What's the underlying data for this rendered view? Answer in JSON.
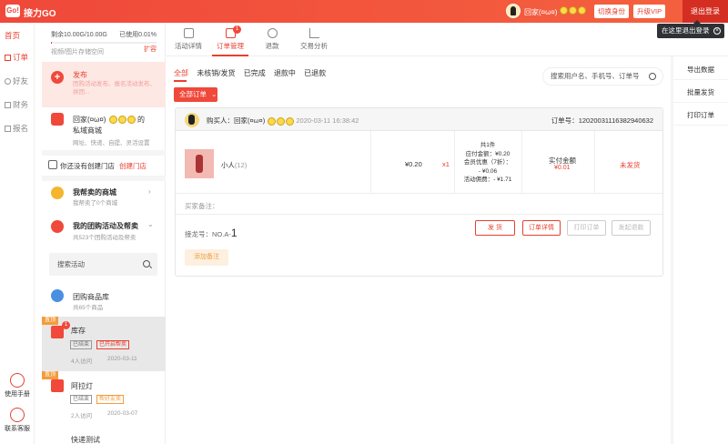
{
  "header": {
    "logo": "Go!",
    "brand": "接力GO",
    "user_name": "回家(¤ω¤)",
    "switch_identity": "切换身份",
    "upgrade_vip": "升级VIP",
    "logout": "退出登录",
    "tooltip": "在这里退出登录"
  },
  "leftnav": {
    "items": [
      {
        "label": "首页"
      },
      {
        "label": "订单"
      },
      {
        "label": "好友"
      },
      {
        "label": "财务"
      },
      {
        "label": "报名"
      }
    ],
    "manual": "使用手册",
    "support": "联系客服"
  },
  "storage": {
    "remaining": "剩余10.00G/10.00G",
    "used": "已使用0.01%",
    "desc": "视频/图片存储空间",
    "expand": "扩容"
  },
  "midpanel": {
    "publish_title": "发布",
    "publish_sub": "团购活动发布、报名活动发布、拼团...",
    "mall_title": "回家(¤ω¤)",
    "mall_title_suffix": "的",
    "mall_title2": "私域商城",
    "mall_sub": "网址、快递、自提、灵活设置",
    "store_hint": "你还没有创建门店",
    "create_store": "创建门店",
    "help_sell_title": "我帮卖的商城",
    "help_sell_sub": "我帮卖了0个商城",
    "my_groups_title": "我的团购活动及帮卖",
    "my_groups_sub": "共523个团购活动及帮卖",
    "search_placeholder": "搜索活动",
    "lib_title": "团购商品库",
    "lib_sub": "共65个商品",
    "act1_tag": "置顶",
    "act1_badge": "1",
    "act1_title": "库存",
    "act1_chip1": "已结束",
    "act1_chip2": "已开启帮卖",
    "act1_visits": "4人访问",
    "act1_date": "2020-03-11",
    "act2_tag": "置顶",
    "act2_title": "阿拉灯",
    "act2_chip1": "已结束",
    "act2_chip2": "帮好友卖",
    "act2_visits": "2人访问",
    "act2_date": "2020-03-07",
    "act3_title": "快递测试"
  },
  "tabs": [
    {
      "label": "活动详情"
    },
    {
      "label": "订单管理",
      "badge": "1"
    },
    {
      "label": "退款"
    },
    {
      "label": "交易分析"
    }
  ],
  "filters": [
    "全部",
    "未核销/发货",
    "已完成",
    "退款中",
    "已退款"
  ],
  "order_search_placeholder": "搜索用户名、手机号、订单号",
  "all_orders": "全部订单",
  "right_actions": [
    "导出数据",
    "批量发货",
    "打印订单"
  ],
  "order": {
    "buyer_label": "购买人：",
    "buyer_name": "回家(¤ω¤)",
    "time": "2020-03-11 16:38:42",
    "order_no_label": "订单号：",
    "order_no": "12020031116382940632",
    "product_name": "小人",
    "product_qty_tag": "(12)",
    "price": "¥0.20",
    "qty": "x1",
    "fee_count": "共1件",
    "fee_payable": "应付金额：¥0.20",
    "fee_member": "会员优惠（7折）：",
    "fee_member_val": "- ¥0.06",
    "fee_activity": "活动佣费：- ¥1.71",
    "paid_label": "实付金额",
    "paid_value": "¥0.01",
    "status": "未发货",
    "remark_label": "买家备注：",
    "pickup_label": "接龙号：NO.A-",
    "pickup_no": "1",
    "btn_ship": "发 货",
    "btn_detail": "订单详情",
    "btn_print": "打印订单",
    "btn_refund": "发起退款",
    "btn_add_note": "添加备注"
  },
  "colors": {
    "accent": "#f0483a",
    "tag": "#f39c3c"
  }
}
